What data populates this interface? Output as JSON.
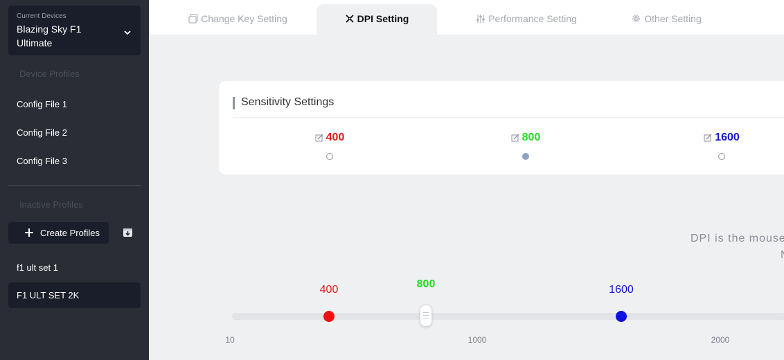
{
  "sidebar": {
    "device_caption": "Current Devices",
    "device_name": "Blazing Sky F1 Ultimate",
    "device_profiles_title": "Device Profiles",
    "device_profiles": [
      "Config File 1",
      "Config File 2",
      "Config File 3"
    ],
    "inactive_profiles_title": "Inactive Profiles",
    "create_button": "Create Profiles",
    "inactive_profiles": [
      "f1 ult set 1",
      "F1 ULT SET 2K"
    ]
  },
  "tabs": [
    {
      "label": "Change Key Setting",
      "icon": "key-icon"
    },
    {
      "label": "DPI Setting",
      "icon": "dpi-icon"
    },
    {
      "label": "Performance Setting",
      "icon": "sliders-icon"
    },
    {
      "label": "Other Setting",
      "icon": "gear-icon"
    }
  ],
  "active_tab": "DPI Setting",
  "sensitivity": {
    "title": "Sensitivity Settings",
    "levels": [
      {
        "value": "400",
        "color": "#e31a1a",
        "selected": false
      },
      {
        "value": "800",
        "color": "#22dd22",
        "selected": true
      },
      {
        "value": "1600",
        "color": "#1414d6",
        "selected": false
      }
    ]
  },
  "description": {
    "line1": "DPI is the mouse",
    "line2": "N"
  },
  "slider": {
    "labels": [
      "400",
      "800",
      "1600"
    ],
    "ticks": [
      "10",
      "1000",
      "2000"
    ]
  }
}
